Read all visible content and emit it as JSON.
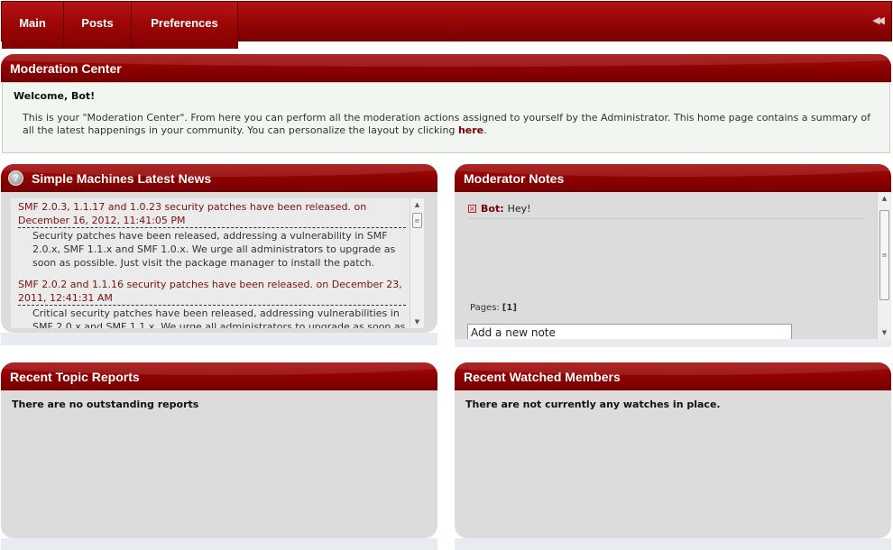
{
  "menu": {
    "tabs": [
      {
        "label": "Main"
      },
      {
        "label": "Posts"
      },
      {
        "label": "Preferences"
      }
    ],
    "collapse_icon": "double-chevron-left-icon"
  },
  "moderation": {
    "title": "Moderation Center",
    "welcome_title": "Welcome, Bot!",
    "welcome_text": "This is your \"Moderation Center\". From here you can perform all the moderation actions assigned to yourself by the Administrator. This home page contains a summary of all the latest happenings in your community. You can personalize the layout by clicking",
    "welcome_link": "here",
    "welcome_end": "."
  },
  "news": {
    "title": "Simple Machines Latest News",
    "items": [
      {
        "subject": "SMF 2.0.3, 1.1.17 and 1.0.23 security patches have been released.",
        "date": "on December 16, 2012, 11:41:05 PM",
        "body": "Security patches have been released, addressing a vulnerability in SMF 2.0.x, SMF 1.1.x and SMF 1.0.x. We urge all administrators to upgrade as soon as possible. Just visit the package manager to install the patch."
      },
      {
        "subject": "SMF 2.0.2 and 1.1.16 security patches have been released.",
        "date": "on December 23, 2011, 12:41:31 AM",
        "body": "Critical security patches have been released, addressing vulnerabilities in SMF 2.0.x and SMF 1.1.x. We urge all administrators to upgrade as soon as possible."
      }
    ]
  },
  "notes": {
    "title": "Moderator Notes",
    "items": [
      {
        "author": "Bot:",
        "text": "Hey!"
      }
    ],
    "pages_label": "Pages:",
    "current_page": "[1]",
    "input_value": "Add a new note"
  },
  "reports": {
    "title": "Recent Topic Reports",
    "empty": "There are no outstanding reports"
  },
  "watched": {
    "title": "Recent Watched Members",
    "empty": "There are not currently any watches in place."
  },
  "colors": {
    "accent": "#8c0000",
    "panel_bg": "#dcdcdc",
    "welcome_bg": "#f1f6f0"
  }
}
